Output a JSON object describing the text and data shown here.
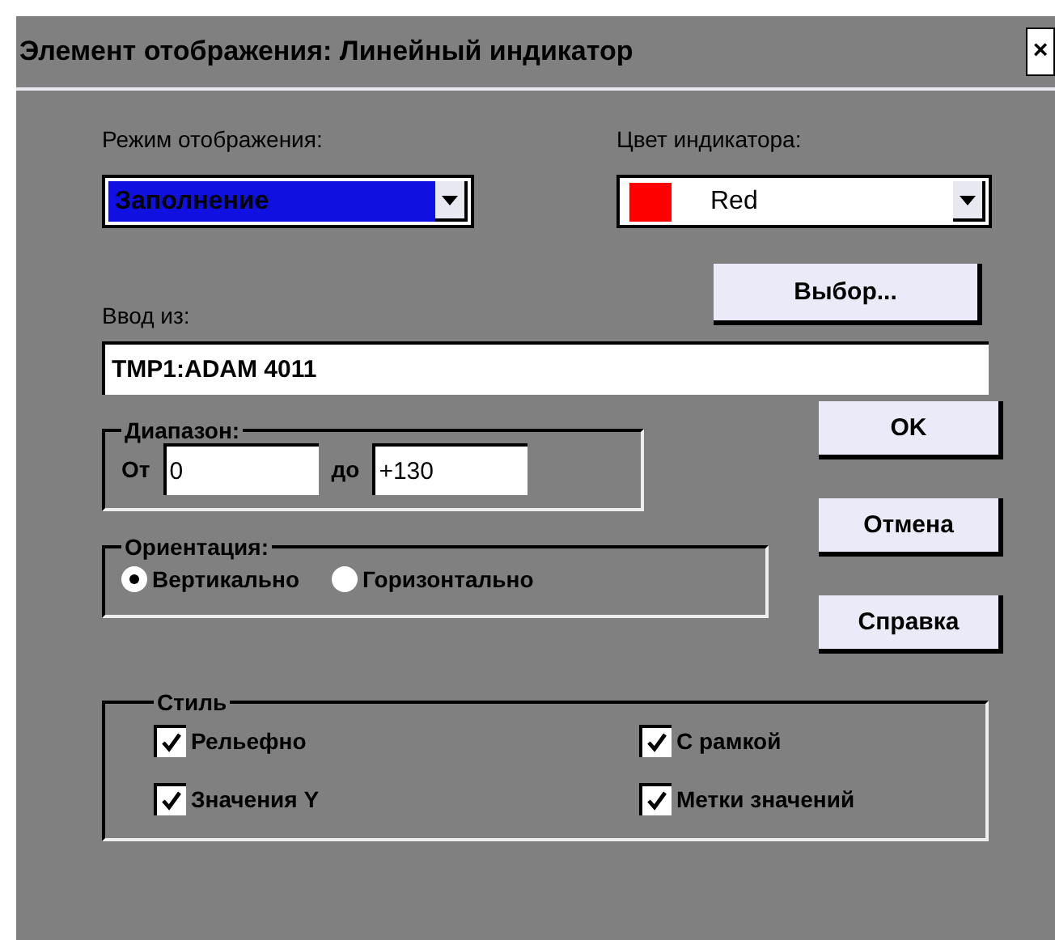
{
  "window": {
    "title": "Элемент отображения: Линейный индикатор",
    "close": "×"
  },
  "display_mode": {
    "label": "Режим отображения:",
    "value": "Заполнение"
  },
  "indicator_color": {
    "label": "Цвет индикатора:",
    "value": "Red",
    "color": "#ff0000"
  },
  "choose_button": "Выбор...",
  "input_from": {
    "label": "Ввод из:",
    "value": "TMP1:ADAM 4011"
  },
  "range": {
    "title": "Диапазон:",
    "from_label": "От",
    "from_value": "0",
    "to_label": "до",
    "to_value": "+130"
  },
  "orientation": {
    "title": "Ориентация:",
    "options": [
      {
        "label": "Вертикально",
        "selected": true
      },
      {
        "label": "Горизонтально",
        "selected": false
      }
    ]
  },
  "style": {
    "title": "Стиль",
    "options": [
      {
        "label": "Рельефно",
        "checked": true
      },
      {
        "label": "С рамкой",
        "checked": true
      },
      {
        "label": "Значения Y",
        "checked": true
      },
      {
        "label": "Метки значений",
        "checked": true
      }
    ]
  },
  "buttons": [
    "OK",
    "Отмена",
    "Справка"
  ]
}
